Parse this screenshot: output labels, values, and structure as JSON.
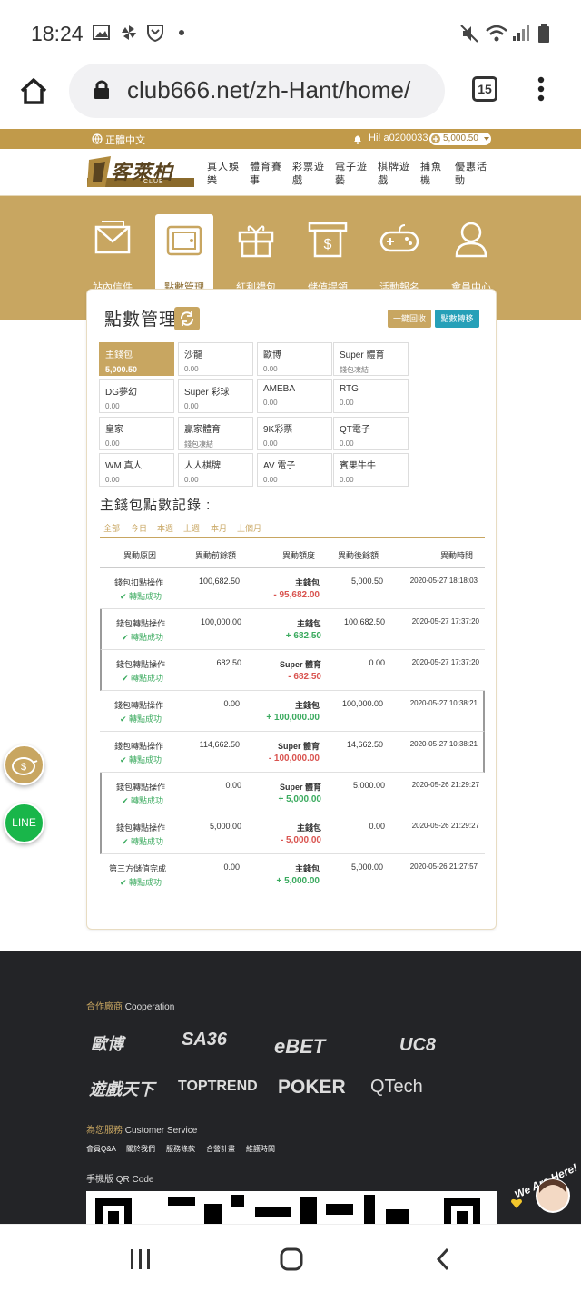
{
  "status_bar": {
    "time": "18:24"
  },
  "browser": {
    "url": "club666.net/zh-Hant/home/",
    "tab_count": "15"
  },
  "site": {
    "language": "正體中文",
    "greeting": "Hi! a0200033",
    "balance_badge": "5,000.50",
    "logo_text": "客萊柏",
    "logo_sub": "CLUB",
    "nav": [
      "真人娛樂",
      "體育賽事",
      "彩票遊戲",
      "電子遊藝",
      "棋牌遊戲",
      "捕魚機",
      "優惠活動"
    ]
  },
  "member_tiles": [
    "站內信件",
    "點數管理",
    "紅利禮包",
    "儲值提領",
    "活動報名",
    "會員中心"
  ],
  "points": {
    "title": "點數管理",
    "recall_button": "一鍵回收",
    "transfer_button": "點數轉移",
    "wallets": [
      {
        "name": "主錢包",
        "value": "5,000.50",
        "active": true
      },
      {
        "name": "沙龍",
        "value": "0.00"
      },
      {
        "name": "歐博",
        "value": "0.00"
      },
      {
        "name": "Super 體育",
        "value": "錢包凍結"
      },
      {
        "name": "DG夢幻",
        "value": "0.00"
      },
      {
        "name": "Super 彩球",
        "value": "0.00"
      },
      {
        "name": "AMEBA",
        "value": "0.00"
      },
      {
        "name": "RTG",
        "value": "0.00"
      },
      {
        "name": "皇家",
        "value": "0.00"
      },
      {
        "name": "贏家體育",
        "value": "錢包凍結"
      },
      {
        "name": "9K彩票",
        "value": "0.00"
      },
      {
        "name": "QT電子",
        "value": "0.00"
      },
      {
        "name": "WM 真人",
        "value": "0.00"
      },
      {
        "name": "人人棋牌",
        "value": "0.00"
      },
      {
        "name": "AV 電子",
        "value": "0.00"
      },
      {
        "name": "賓果牛牛",
        "value": "0.00"
      }
    ]
  },
  "records": {
    "title": "主錢包點數記錄 :",
    "filters": [
      "全部",
      "今日",
      "本週",
      "上週",
      "本月",
      "上個月"
    ],
    "headers": [
      "異動原因",
      "異動前餘額",
      "異動額度",
      "異動後餘額",
      "異動時間"
    ],
    "rows": [
      {
        "reason": "錢包扣點操作",
        "status": "轉點成功",
        "before": "100,682.50",
        "wallet": "主錢包",
        "amount": "- 95,682.00",
        "after": "5,000.50",
        "time": "2020-05-27 18:18:03"
      },
      {
        "reason": "錢包轉點操作",
        "status": "轉點成功",
        "before": "100,000.00",
        "wallet": "主錢包",
        "amount": "+ 682.50",
        "after": "100,682.50",
        "time": "2020-05-27 17:37:20"
      },
      {
        "reason": "錢包轉點操作",
        "status": "轉點成功",
        "before": "682.50",
        "wallet": "Super 體育",
        "amount": "- 682.50",
        "after": "0.00",
        "time": "2020-05-27 17:37:20"
      },
      {
        "reason": "錢包轉點操作",
        "status": "轉點成功",
        "before": "0.00",
        "wallet": "主錢包",
        "amount": "+ 100,000.00",
        "after": "100,000.00",
        "time": "2020-05-27 10:38:21"
      },
      {
        "reason": "錢包轉點操作",
        "status": "轉點成功",
        "before": "114,662.50",
        "wallet": "Super 體育",
        "amount": "- 100,000.00",
        "after": "14,662.50",
        "time": "2020-05-27 10:38:21"
      },
      {
        "reason": "錢包轉點操作",
        "status": "轉點成功",
        "before": "0.00",
        "wallet": "Super 體育",
        "amount": "+ 5,000.00",
        "after": "5,000.00",
        "time": "2020-05-26 21:29:27"
      },
      {
        "reason": "錢包轉點操作",
        "status": "轉點成功",
        "before": "5,000.00",
        "wallet": "主錢包",
        "amount": "- 5,000.00",
        "after": "0.00",
        "time": "2020-05-26 21:29:27"
      },
      {
        "reason": "第三方儲值完成",
        "status": "轉點成功",
        "before": "0.00",
        "wallet": "主錢包",
        "amount": "+ 5,000.00",
        "after": "5,000.00",
        "time": "2020-05-26 21:27:57"
      }
    ]
  },
  "floating": {
    "line_label": "LINE"
  },
  "footer": {
    "coop_zh": "合作廠商",
    "coop_en": "Cooperation",
    "partners": [
      "歐博",
      "SA36",
      "eBET",
      "UC8",
      "遊戲天下",
      "TOPTREND",
      "POKER",
      "QTech"
    ],
    "service_zh": "為您服務",
    "service_en": "Customer Service",
    "service_links": [
      "會員Q&A",
      "關於我們",
      "服務條款",
      "合營計畫",
      "維護時間"
    ],
    "qr_zh": "手機版",
    "qr_en": "QR Code",
    "we_are_here": "We Are Here!"
  },
  "colors": {
    "gold": "#c8a661",
    "teal": "#26a0b8",
    "positive": "#3aaa5e",
    "negative": "#d9534f",
    "footer_bg": "#232427"
  }
}
